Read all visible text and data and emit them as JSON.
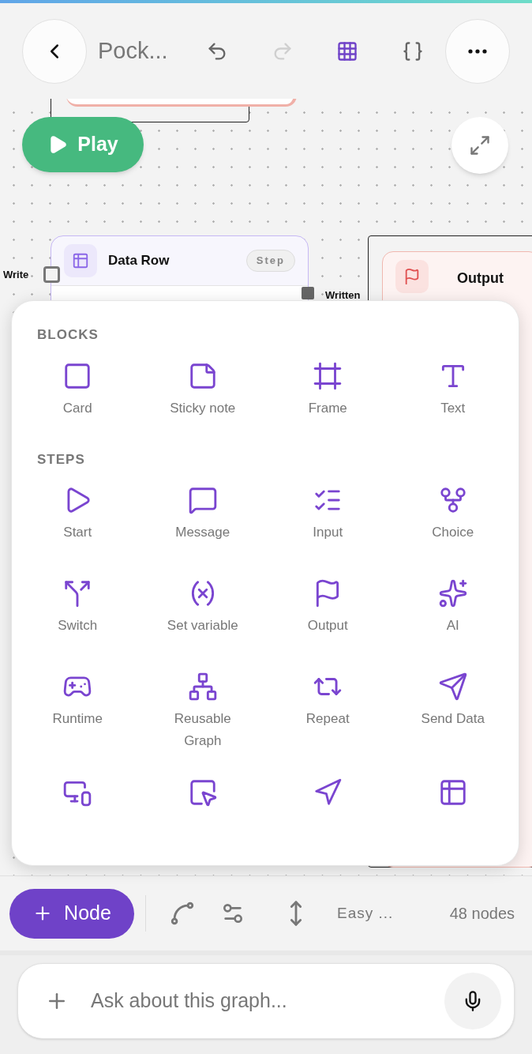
{
  "header": {
    "title": "Pock...",
    "tools": [
      {
        "kind": "undo",
        "disabled": false,
        "selected": false
      },
      {
        "kind": "redo",
        "disabled": true,
        "selected": false
      },
      {
        "kind": "grid",
        "disabled": false,
        "selected": true
      },
      {
        "kind": "code",
        "disabled": false,
        "selected": false
      }
    ]
  },
  "play_button": "Play",
  "canvas": {
    "data_row_node": {
      "title": "Data Row",
      "badge": "Step",
      "in_port": "Write",
      "out_port": "Written"
    },
    "output_node": {
      "title": "Output"
    }
  },
  "palette": {
    "sections": [
      {
        "heading": "BLOCKS",
        "items": [
          {
            "kind": "card",
            "label": "Card"
          },
          {
            "kind": "sticky",
            "label": "Sticky note"
          },
          {
            "kind": "frame",
            "label": "Frame"
          },
          {
            "kind": "text",
            "label": "Text"
          }
        ]
      },
      {
        "heading": "STEPS",
        "items": [
          {
            "kind": "start",
            "label": "Start"
          },
          {
            "kind": "message",
            "label": "Message"
          },
          {
            "kind": "input",
            "label": "Input"
          },
          {
            "kind": "choice",
            "label": "Choice"
          },
          {
            "kind": "switch",
            "label": "Switch"
          },
          {
            "kind": "variable",
            "label": "Set variable"
          },
          {
            "kind": "output",
            "label": "Output"
          },
          {
            "kind": "ai",
            "label": "AI"
          },
          {
            "kind": "runtime",
            "label": "Runtime"
          },
          {
            "kind": "graph",
            "label": "Reusable Graph"
          },
          {
            "kind": "repeat",
            "label": "Repeat"
          },
          {
            "kind": "send",
            "label": "Send Data"
          },
          {
            "kind": "screen"
          },
          {
            "kind": "widget"
          },
          {
            "kind": "navigate"
          },
          {
            "kind": "datarow"
          }
        ]
      }
    ]
  },
  "toolbar": {
    "node_button": "Node",
    "mode": "Easy ...",
    "count": "48 nodes"
  },
  "chat": {
    "placeholder": "Ask about this graph..."
  }
}
